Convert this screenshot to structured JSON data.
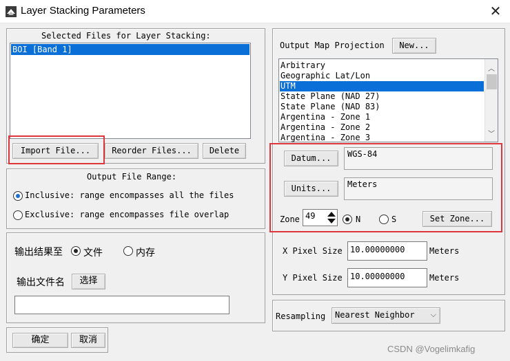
{
  "window": {
    "title": "Layer Stacking Parameters",
    "close_glyph": "✕",
    "icon_name": "layer-stack-icon"
  },
  "left": {
    "selected_files": {
      "heading": "Selected Files for Layer Stacking:",
      "items": [
        "BOI [Band 1]"
      ],
      "selected_index": 0,
      "import_label": "Import File...",
      "reorder_label": "Reorder Files...",
      "delete_label": "Delete"
    },
    "range": {
      "heading": "Output File Range:",
      "inclusive_label": "Inclusive: range encompasses all the files",
      "exclusive_label": "Exclusive: range encompasses file overlap",
      "selected": "inclusive"
    },
    "output": {
      "output_to_label": "输出结果至",
      "file_label": "文件",
      "memory_label": "内存",
      "selected": "file",
      "filename_label": "输出文件名",
      "choose_label": "选择",
      "filename_value": ""
    },
    "ok_label": "确定",
    "cancel_label": "取消"
  },
  "right": {
    "projection_label": "Output Map Projection",
    "new_label": "New...",
    "projections": [
      "Arbitrary",
      "Geographic Lat/Lon",
      "UTM",
      "State Plane (NAD 27)",
      "State Plane (NAD 83)",
      "Argentina - Zone 1",
      "Argentina - Zone 2",
      "Argentina - Zone 3"
    ],
    "selected_projection": "UTM",
    "datum_label": "Datum...",
    "datum_value": "WGS-84",
    "units_label": "Units...",
    "units_value": "Meters",
    "zone_label": "Zone",
    "zone_value": "49",
    "n_label": "N",
    "s_label": "S",
    "hemisphere": "N",
    "set_zone_label": "Set Zone...",
    "x_pixel_label": "X Pixel Size",
    "x_pixel_value": "10.00000000",
    "x_unit": "Meters",
    "y_pixel_label": "Y Pixel Size",
    "y_pixel_value": "10.00000000",
    "y_unit": "Meters",
    "resampling_label": "Resampling",
    "resampling_value": "Nearest Neighbor"
  },
  "watermark": "CSDN @Vogelimkafig",
  "colors": {
    "selection": "#0a6fd6",
    "highlight_box": "#e0353a"
  }
}
